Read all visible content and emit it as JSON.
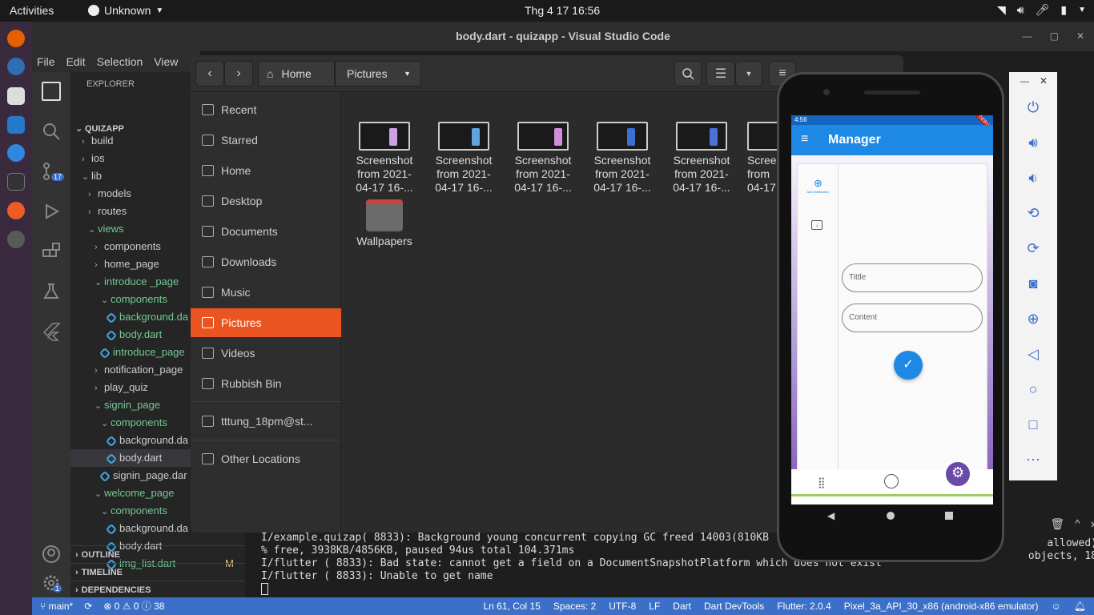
{
  "topbar": {
    "activities": "Activities",
    "app": "Unknown",
    "clock": "Thg 4 17  16:56"
  },
  "vscode": {
    "title": "body.dart - quizapp - Visual Studio Code",
    "menu": [
      "File",
      "Edit",
      "Selection",
      "View"
    ],
    "explorer_header": "EXPLORER",
    "scm_badge": "17",
    "settings_badge": "1",
    "tree": [
      {
        "label": "QUIZAPP",
        "indent": 0,
        "chev": "v",
        "bold": true
      },
      {
        "label": "build",
        "indent": 1,
        "chev": ">"
      },
      {
        "label": "ios",
        "indent": 1,
        "chev": ">"
      },
      {
        "label": "lib",
        "indent": 1,
        "chev": "v"
      },
      {
        "label": "models",
        "indent": 2,
        "chev": ">"
      },
      {
        "label": "routes",
        "indent": 2,
        "chev": ">"
      },
      {
        "label": "views",
        "indent": 2,
        "chev": "v",
        "green": true
      },
      {
        "label": "components",
        "indent": 3,
        "chev": ">"
      },
      {
        "label": "home_page",
        "indent": 3,
        "chev": ">"
      },
      {
        "label": "introduce _page",
        "indent": 3,
        "chev": "v",
        "green": true
      },
      {
        "label": "components",
        "indent": 4,
        "chev": "v",
        "green": true
      },
      {
        "label": "background.da",
        "indent": 5,
        "dart": true,
        "green": true
      },
      {
        "label": "body.dart",
        "indent": 5,
        "dart": true,
        "green": true
      },
      {
        "label": "introduce_page",
        "indent": 4,
        "dart": true,
        "green": true
      },
      {
        "label": "notification_page",
        "indent": 3,
        "chev": ">"
      },
      {
        "label": "play_quiz",
        "indent": 3,
        "chev": ">"
      },
      {
        "label": "signin_page",
        "indent": 3,
        "chev": "v",
        "green": true
      },
      {
        "label": "components",
        "indent": 4,
        "chev": "v",
        "green": true
      },
      {
        "label": "background.da",
        "indent": 5,
        "dart": true
      },
      {
        "label": "body.dart",
        "indent": 5,
        "dart": true,
        "selected": true
      },
      {
        "label": "signin_page.dar",
        "indent": 4,
        "dart": true
      },
      {
        "label": "welcome_page",
        "indent": 3,
        "chev": "v",
        "green": true
      },
      {
        "label": "components",
        "indent": 4,
        "chev": "v",
        "green": true
      },
      {
        "label": "background.da",
        "indent": 5,
        "dart": true
      },
      {
        "label": "body.dart",
        "indent": 5,
        "dart": true
      },
      {
        "label": "img_list.dart",
        "indent": 5,
        "dart": true,
        "green": true,
        "badge": "M"
      }
    ],
    "sections": [
      "OUTLINE",
      "TIMELINE",
      "DEPENDENCIES"
    ],
    "terminal_lines": [
      "I/example.quizap( 8833): Background young concurrent copying GC freed 14003(810KB",
      "% free, 3938KB/4856KB, paused 94us total 104.371ms",
      "I/flutter ( 8833): Bad state: cannot get a field on a DocumentSnapshotPlatform which does not exist",
      "I/flutter ( 8833): Unable to get name"
    ],
    "terminal_right": [
      "allowed)",
      "objects, 18"
    ],
    "status_left": [
      "main*",
      "⊗ 0 ⚠ 0 ⓘ 38"
    ],
    "status_right": [
      "Ln 61, Col 15",
      "Spaces: 2",
      "UTF-8",
      "LF",
      "Dart",
      "Dart DevTools",
      "Flutter: 2.0.4",
      "Pixel_3a_API_30_x86 (android-x86 emulator)"
    ]
  },
  "files": {
    "breadcrumb_home": "Home",
    "breadcrumb_current": "Pictures",
    "places": [
      "Recent",
      "Starred",
      "Home",
      "Desktop",
      "Documents",
      "Downloads",
      "Music",
      "Pictures",
      "Videos",
      "Rubbish Bin",
      "tttung_18pm@st...",
      "Other Locations"
    ],
    "selected_place": "Pictures",
    "items": [
      {
        "name": "Screenshot from 2021-04-17 16-...",
        "type": "image"
      },
      {
        "name": "Screenshot from 2021-04-17 16-...",
        "type": "image"
      },
      {
        "name": "Screenshot from 2021-04-17 16-...",
        "type": "image"
      },
      {
        "name": "Screenshot from 2021-04-17 16-...",
        "type": "image"
      },
      {
        "name": "Screenshot from 2021-04-17 16-...",
        "type": "image"
      },
      {
        "name": "Scree from 04-17",
        "type": "image"
      },
      {
        "name": "Wallpapers",
        "type": "folder"
      }
    ]
  },
  "phone": {
    "status_time": "4:56",
    "debug_ribbon": "DEBUG",
    "app_title": "Manager",
    "rail_label": "Add Notification",
    "field_title_placeholder": "Tittle",
    "field_content_placeholder": "Content",
    "accent_color": "#1e88e5"
  },
  "emulator_controls": [
    "power",
    "volume-up",
    "volume-down",
    "rotate-left",
    "rotate-right",
    "screenshot",
    "zoom",
    "back",
    "home",
    "overview",
    "more"
  ]
}
